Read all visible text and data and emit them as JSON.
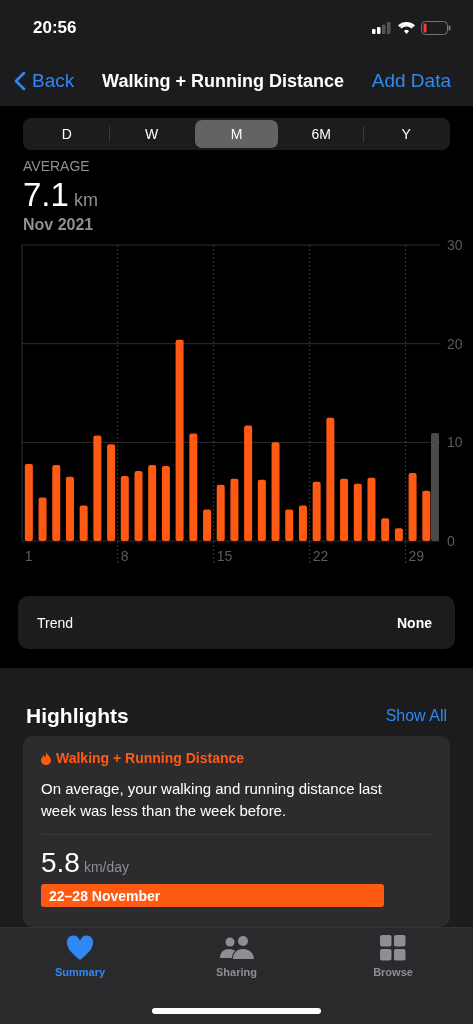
{
  "status_bar": {
    "time": "20:56"
  },
  "nav": {
    "back": "Back",
    "title": "Walking + Running Distance",
    "action": "Add Data"
  },
  "ranges": [
    {
      "label": "D",
      "selected": false
    },
    {
      "label": "W",
      "selected": false
    },
    {
      "label": "M",
      "selected": true
    },
    {
      "label": "6M",
      "selected": false
    },
    {
      "label": "Y",
      "selected": false
    }
  ],
  "summary": {
    "label": "AVERAGE",
    "value": "7.1",
    "unit": "km",
    "period": "Nov 2021"
  },
  "chart_data": {
    "type": "bar",
    "x": [
      1,
      2,
      3,
      4,
      5,
      6,
      7,
      8,
      9,
      10,
      11,
      12,
      13,
      14,
      15,
      16,
      17,
      18,
      19,
      20,
      21,
      22,
      23,
      24,
      25,
      26,
      27,
      28,
      29,
      30
    ],
    "grid": true,
    "series": [
      {
        "color": "#ff5a14",
        "values": [
          7.8,
          4.4,
          7.7,
          6.5,
          3.6,
          10.7,
          9.8,
          6.6,
          7.1,
          7.7,
          7.6,
          20.4,
          10.9,
          3.2,
          5.7,
          6.3,
          11.7,
          6.2,
          10.0,
          3.2,
          3.6,
          6.0,
          12.5,
          6.3,
          5.8,
          6.4,
          2.3,
          1.3,
          6.9,
          5.1
        ]
      }
    ],
    "xlim": [
      0.5,
      31
    ],
    "ylim": [
      0,
      30
    ],
    "yticks": [
      0,
      10,
      20,
      30
    ],
    "xticks": [
      1,
      8,
      15,
      22,
      29
    ]
  },
  "trend": {
    "label": "Trend",
    "value": "None"
  },
  "highlights": {
    "title": "Highlights",
    "action": "Show All",
    "card": {
      "category": "Walking + Running Distance",
      "text": "On average, your walking and running distance last week was less than the week before.",
      "value": "5.8",
      "unit": "km/day",
      "range": "22–28 November"
    }
  },
  "tabs": [
    {
      "label": "Summary",
      "selected": true
    },
    {
      "label": "Sharing",
      "selected": false
    },
    {
      "label": "Browse",
      "selected": false
    }
  ]
}
